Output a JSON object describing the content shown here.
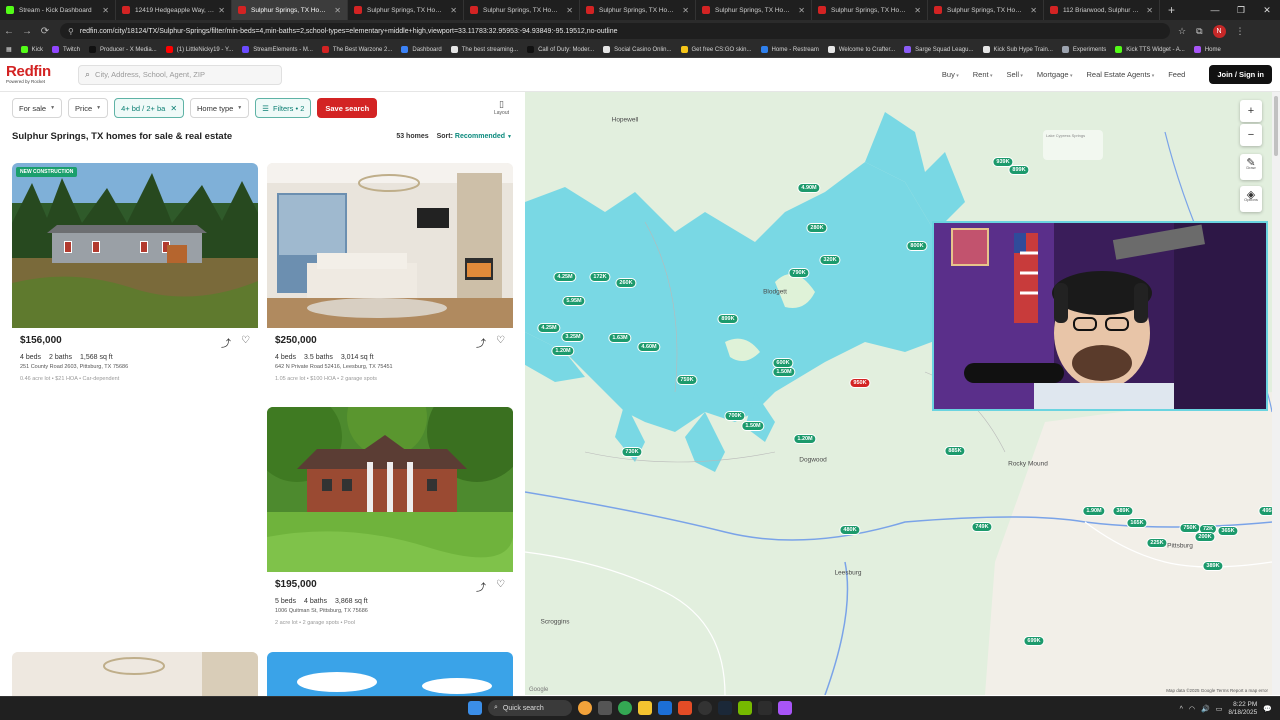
{
  "browser": {
    "tabs": [
      {
        "title": "Stream - Kick Dashboard",
        "color": "#53fc18"
      },
      {
        "title": "12419 Hedgeapple Way, Louis",
        "color": "#d32323"
      },
      {
        "title": "Sulphur Springs, TX Homes for",
        "color": "#d32323",
        "active": true
      },
      {
        "title": "Sulphur Springs, TX Homes fo",
        "color": "#d32323"
      },
      {
        "title": "Sulphur Springs, TX Homes fo",
        "color": "#d32323"
      },
      {
        "title": "Sulphur Springs, TX Homes fo",
        "color": "#d32323"
      },
      {
        "title": "Sulphur Springs, TX Homes fo",
        "color": "#d32323"
      },
      {
        "title": "Sulphur Springs, TX Homes fo",
        "color": "#d32323"
      },
      {
        "title": "Sulphur Springs, TX Homes fo",
        "color": "#d32323"
      },
      {
        "title": "112 Briarwood, Sulphur Springs",
        "color": "#d32323"
      }
    ],
    "url": "redfin.com/city/18124/TX/Sulphur-Springs/filter/min-beds=4,min-baths=2,school-types=elementary+middle+high,viewport=33.11783:32.95953:-94.93849:-95.19512,no-outline",
    "profile_initial": "N",
    "bookmarks": [
      {
        "label": "Kick",
        "color": "#53fc18"
      },
      {
        "label": "Twitch",
        "color": "#9146ff"
      },
      {
        "label": "Producer - X Media...",
        "color": "#111111"
      },
      {
        "label": "(1) LittleNicky19 - Y...",
        "color": "#ff0000"
      },
      {
        "label": "StreamElements - M...",
        "color": "#6b4bff"
      },
      {
        "label": "The Best Warzone 2...",
        "color": "#d32323"
      },
      {
        "label": "Dashboard",
        "color": "#3b82f6"
      },
      {
        "label": "The best streaming...",
        "color": "#e5e5e5"
      },
      {
        "label": "Call of Duty: Moder...",
        "color": "#111111"
      },
      {
        "label": "Social Casino Onlin...",
        "color": "#e5e5e5"
      },
      {
        "label": "Get free CS:GO skin...",
        "color": "#f5c518"
      },
      {
        "label": "Home - Restream",
        "color": "#2f80ed"
      },
      {
        "label": "Welcome to Crafter...",
        "color": "#e5e5e5"
      },
      {
        "label": "Sarge Squad Leagu...",
        "color": "#8b5cf6"
      },
      {
        "label": "Kick Sub Hype Train...",
        "color": "#e5e5e5"
      },
      {
        "label": "Experiments",
        "color": "#9ca3af"
      },
      {
        "label": "Kick TTS Widget - A...",
        "color": "#53fc18"
      },
      {
        "label": "Home",
        "color": "#a855f7"
      }
    ]
  },
  "header": {
    "brand": "Redfin",
    "brand_sub": "Powered by Rocket",
    "search_placeholder": "City, Address, School, Agent, ZIP",
    "nav": [
      "Buy",
      "Rent",
      "Sell",
      "Mortgage",
      "Real Estate Agents"
    ],
    "feed": "Feed",
    "join": "Join / Sign in"
  },
  "filters": {
    "for_sale": "For sale",
    "price": "Price",
    "beds_baths": "4+ bd / 2+ ba",
    "home_type": "Home type",
    "more": "Filters • 2",
    "save": "Save search",
    "layout": "Layout"
  },
  "listing": {
    "title": "Sulphur Springs, TX homes for sale & real estate",
    "count": "53 homes",
    "sort_label": "Sort:",
    "sort_value": "Recommended",
    "cards": [
      {
        "badge": "NEW CONSTRUCTION",
        "price": "$156,000",
        "beds": "4 beds",
        "baths": "2 baths",
        "sqft": "1,568 sq ft",
        "address": "251 County Road 2603, Pittsburg, TX 75686",
        "meta": "0.46 acre lot • $21 HOA • Car-dependent"
      },
      {
        "badge": "",
        "price": "$250,000",
        "beds": "4 beds",
        "baths": "3.5 baths",
        "sqft": "3,014 sq ft",
        "address": "642 N Private Road 52416, Leesburg, TX 75451",
        "meta": "1.05 acre lot • $100 HOA • 2 garage spots"
      },
      {
        "badge": "",
        "price": "$195,000",
        "beds": "5 beds",
        "baths": "4 baths",
        "sqft": "3,868 sq ft",
        "address": "1006 Quitman St, Pittsburg, TX 75686",
        "meta": "2 acre lot • 2 garage spots • Pool"
      }
    ]
  },
  "map": {
    "places": [
      "Hopewell",
      "Blodgett",
      "Dogwood",
      "Rocky Mound",
      "Leesburg",
      "Scroggins",
      "Pittsburg"
    ],
    "pins": [
      "939K",
      "899K",
      "4.90M",
      "280K",
      "800K",
      "320K",
      "790K",
      "4.25M",
      "172K",
      "260K",
      "5.95M",
      "899K",
      "4.25M",
      "3.25M",
      "1.63M",
      "4.60M",
      "1.20M",
      "759K",
      "600K",
      "1.50M",
      "950K",
      "700K",
      "1.50M",
      "730K",
      "1.20M",
      "885K",
      "480K",
      "749K",
      "1.90M",
      "389K",
      "165K",
      "750K",
      "72K",
      "200K",
      "365K",
      "225K",
      "389K",
      "699K",
      "495"
    ],
    "attribution": "Map data ©2025 Google   Terms   Report a map error",
    "google": "Google",
    "draw": "Draw",
    "options": "Options",
    "faded_box": "Lake Cypress Springs"
  },
  "taskbar": {
    "search": "Quick search",
    "time": "8:22 PM",
    "date": "8/18/2025"
  }
}
